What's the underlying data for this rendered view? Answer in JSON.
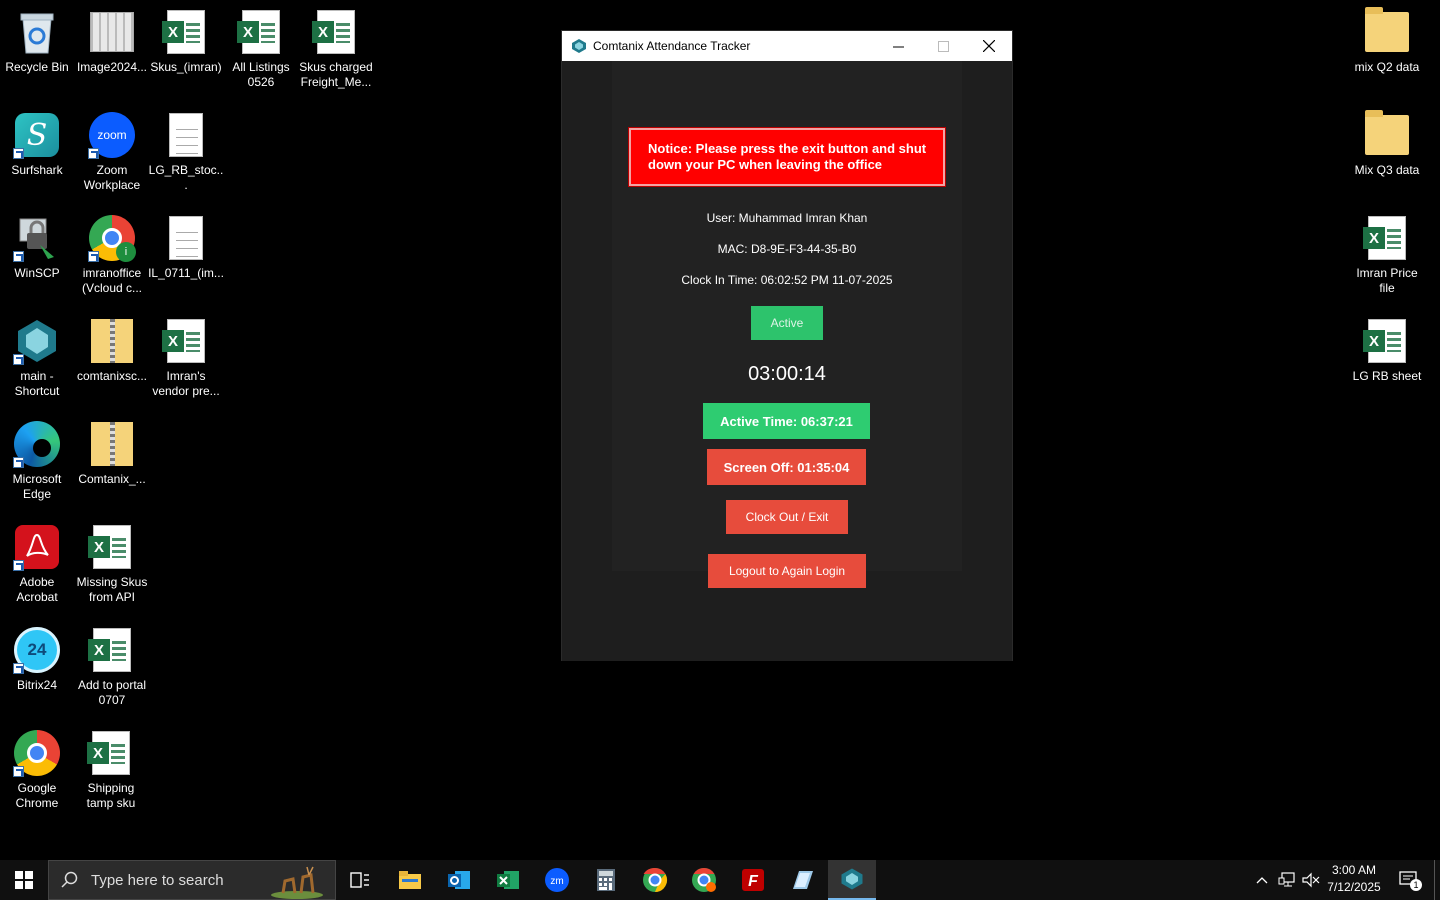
{
  "desktop": {
    "icons_left": [
      {
        "label": "Recycle Bin"
      },
      {
        "label": "Image2024..."
      },
      {
        "label": "Skus_(imran)"
      },
      {
        "label": "All Listings 0526"
      },
      {
        "label": "Skus charged Freight_Me..."
      },
      {
        "label": "Surfshark"
      },
      {
        "label": "Zoom Workplace"
      },
      {
        "label": "LG_RB_stoc..."
      },
      {
        "label": "WinSCP"
      },
      {
        "label": "imranoffice (Vcloud c..."
      },
      {
        "label": "IL_0711_(im..."
      },
      {
        "label": "main - Shortcut"
      },
      {
        "label": "comtanixsc..."
      },
      {
        "label": "Imran's vendor pre..."
      },
      {
        "label": "Microsoft Edge"
      },
      {
        "label": "Comtanix_..."
      },
      {
        "label": "Adobe Acrobat"
      },
      {
        "label": "Missing Skus from API"
      },
      {
        "label": "Bitrix24"
      },
      {
        "label": "Add to portal 0707"
      },
      {
        "label": "Google Chrome"
      },
      {
        "label": "Shipping tamp sku"
      }
    ],
    "icons_right": [
      {
        "label": "mix Q2 data"
      },
      {
        "label": "Mix Q3 data"
      },
      {
        "label": "Imran Price file"
      },
      {
        "label": "LG RB sheet"
      }
    ],
    "zoom_logo_text": "zoom",
    "bitrix_logo_text": "24"
  },
  "app": {
    "title": "Comtanix Attendance Tracker",
    "notice": "Notice: Please press the exit button and shut down your PC when leaving the office",
    "user": "User: Muhammad Imran Khan",
    "mac": "MAC: D8-9E-F3-44-35-B0",
    "clock_in": "Clock In Time: 06:02:52 PM 11-07-2025",
    "status": "Active",
    "timer": "03:00:14",
    "active_time": "Active Time: 06:37:21",
    "screen_off": "Screen Off: 01:35:04",
    "clock_out_label": "Clock Out / Exit",
    "logout_label": "Logout to Again Login"
  },
  "taskbar": {
    "search_placeholder": "Type here to search",
    "time": "3:00 AM",
    "date": "7/12/2025",
    "notification_count": "1"
  },
  "colors": {
    "notice_red": "#ff0000",
    "green": "#2ecc71",
    "red_button": "#e74c3c",
    "excel_green": "#1d7044"
  }
}
